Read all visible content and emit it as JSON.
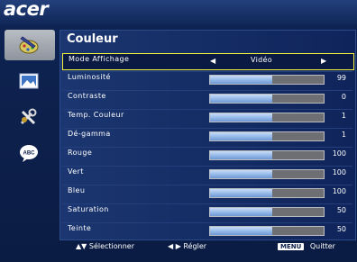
{
  "brand": "acer",
  "sidebar": {
    "items": [
      {
        "icon": "color-pencil-icon",
        "active": true
      },
      {
        "icon": "image-settings-icon",
        "active": false
      },
      {
        "icon": "tools-icon",
        "active": false
      },
      {
        "icon": "language-bubble-icon",
        "active": false,
        "badge": "ABC"
      }
    ]
  },
  "panel": {
    "title": "Couleur",
    "mode": {
      "label": "Mode Affichage",
      "value": "Vidéo"
    },
    "rows": [
      {
        "label": "Luminosité",
        "value": "99",
        "level": 0.55
      },
      {
        "label": "Contraste",
        "value": "0",
        "level": 0.55
      },
      {
        "label": "Temp. Couleur",
        "value": "1",
        "level": 0.55
      },
      {
        "label": "Dé-gamma",
        "value": "1",
        "level": 0.55
      },
      {
        "label": "Rouge",
        "value": "100",
        "level": 0.55
      },
      {
        "label": "Vert",
        "value": "100",
        "level": 0.55
      },
      {
        "label": "Bleu",
        "value": "100",
        "level": 0.55
      },
      {
        "label": "Saturation",
        "value": "50",
        "level": 0.55
      },
      {
        "label": "Teinte",
        "value": "50",
        "level": 0.55
      }
    ]
  },
  "footer": {
    "select": "Sélectionner",
    "adjust": "Régler",
    "menu_key": "MENU",
    "quit": "Quitter"
  },
  "colors": {
    "background": "#0d1f4a",
    "highlight": "#f3f13a",
    "bar_fill": "#8eb4e7",
    "bar_empty": "#6d6f73"
  }
}
